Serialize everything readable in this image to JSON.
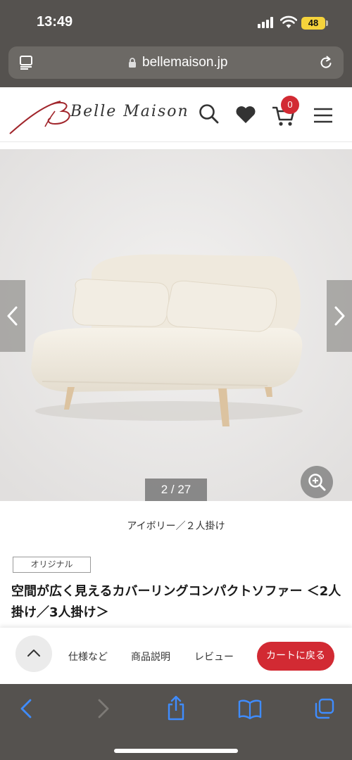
{
  "status_bar": {
    "time": "13:49",
    "battery": "48"
  },
  "browser": {
    "url": "bellemaison.jp"
  },
  "site": {
    "logo_text": "Belle Maison",
    "cart_count": "0"
  },
  "gallery": {
    "counter": "2 / 27",
    "caption": "アイボリー／２人掛け"
  },
  "product": {
    "tag": "オリジナル",
    "title": "空間が広く見えるカバーリングコンパクトソファー ＜2人掛け／3人掛け＞"
  },
  "sticky_nav": {
    "links": [
      "仕様など",
      "商品説明",
      "レビュー"
    ],
    "cart_back": "カートに戻る"
  },
  "colors": {
    "accent": "#d22a33",
    "browser_chrome": "#55524f",
    "toolbar_icon": "#3f8cff",
    "sofa": "#f1ece1"
  },
  "icons": [
    "search-icon",
    "heart-icon",
    "cart-icon",
    "menu-icon",
    "zoom-icon",
    "chevron-left-icon",
    "chevron-right-icon",
    "chevron-up-icon",
    "share-icon",
    "bookmarks-icon",
    "tabs-icon",
    "lock-icon",
    "reload-icon",
    "tab-list-icon"
  ]
}
